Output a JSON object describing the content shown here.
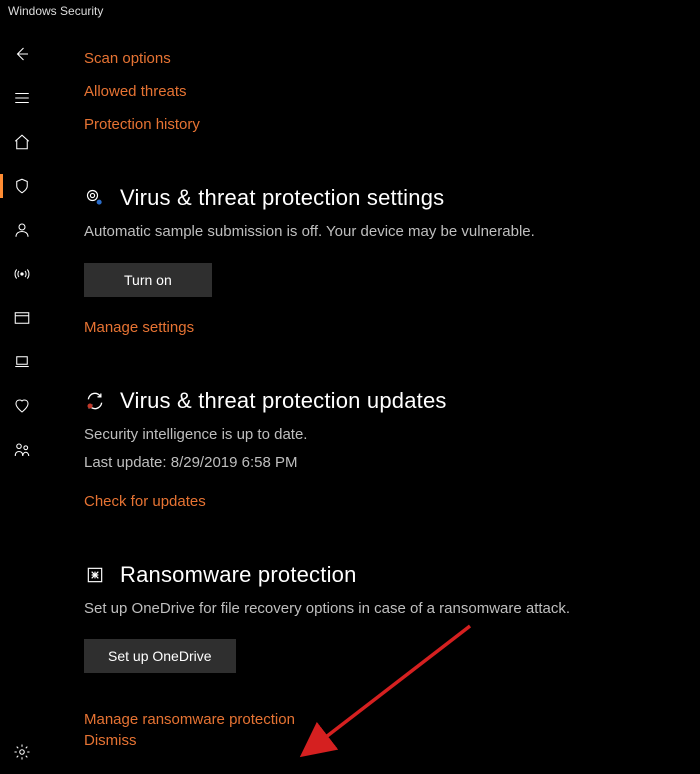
{
  "window_title": "Windows Security",
  "links": {
    "scan_options": "Scan options",
    "allowed_threats": "Allowed threats",
    "protection_history": "Protection history"
  },
  "settings": {
    "title": "Virus & threat protection settings",
    "desc": "Automatic sample submission is off. Your device may be vulnerable.",
    "turn_on": "Turn on",
    "manage": "Manage settings"
  },
  "updates": {
    "title": "Virus & threat protection updates",
    "status": "Security intelligence is up to date.",
    "last_update": "Last update: 8/29/2019 6:58 PM",
    "check": "Check for updates"
  },
  "ransomware": {
    "title": "Ransomware protection",
    "desc": "Set up OneDrive for file recovery options in case of a ransomware attack.",
    "setup": "Set up OneDrive",
    "manage": "Manage ransomware protection",
    "dismiss": "Dismiss"
  }
}
